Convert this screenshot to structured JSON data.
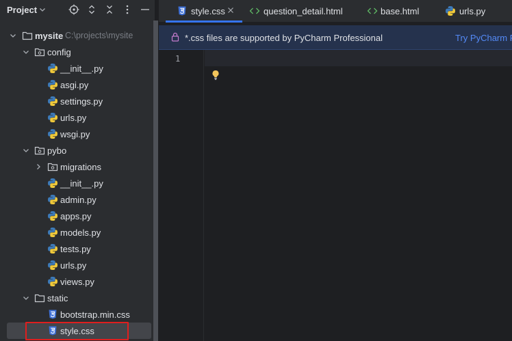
{
  "project_panel": {
    "title": "Project",
    "header_icons": [
      "locate-icon",
      "expand-all-icon",
      "collapse-all-icon",
      "options-icon",
      "hide-icon"
    ]
  },
  "tree": [
    {
      "label": "mysite",
      "hint": "C:\\projects\\mysite",
      "type": "folder",
      "expanded": true,
      "bold": true
    },
    {
      "label": "config",
      "type": "folder",
      "expanded": true
    },
    {
      "label": "__init__.py",
      "type": "python"
    },
    {
      "label": "asgi.py",
      "type": "python"
    },
    {
      "label": "settings.py",
      "type": "python"
    },
    {
      "label": "urls.py",
      "type": "python"
    },
    {
      "label": "wsgi.py",
      "type": "python"
    },
    {
      "label": "pybo",
      "type": "folder",
      "expanded": true
    },
    {
      "label": "migrations",
      "type": "folder",
      "expanded": false
    },
    {
      "label": "__init__.py",
      "type": "python"
    },
    {
      "label": "admin.py",
      "type": "python"
    },
    {
      "label": "apps.py",
      "type": "python"
    },
    {
      "label": "models.py",
      "type": "python"
    },
    {
      "label": "tests.py",
      "type": "python"
    },
    {
      "label": "urls.py",
      "type": "python"
    },
    {
      "label": "views.py",
      "type": "python"
    },
    {
      "label": "static",
      "type": "folder",
      "expanded": true
    },
    {
      "label": "bootstrap.min.css",
      "type": "css"
    },
    {
      "label": "style.css",
      "type": "css",
      "selected": true
    }
  ],
  "tabs": [
    {
      "label": "style.css",
      "icon": "css-icon",
      "active": true
    },
    {
      "label": "question_detail.html",
      "icon": "html-icon"
    },
    {
      "label": "base.html",
      "icon": "html-icon"
    },
    {
      "label": "urls.py",
      "icon": "python-icon"
    }
  ],
  "banner": {
    "message": "*.css files are supported by PyCharm Professional",
    "link": "Try PyCharm Pro"
  },
  "editor": {
    "line_numbers": [
      "1"
    ]
  },
  "colors": {
    "accent": "#3574f0",
    "highlight_box": "#e01e1e",
    "banner_bg": "#25324d",
    "link": "#548af7"
  }
}
